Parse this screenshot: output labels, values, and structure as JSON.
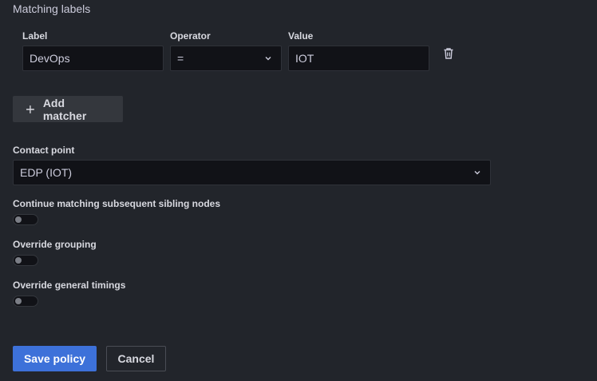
{
  "matching_labels": {
    "title": "Matching labels",
    "columns": {
      "label": "Label",
      "operator": "Operator",
      "value": "Value"
    },
    "row": {
      "label_value": "DevOps",
      "operator_value": "=",
      "value_value": "IOT"
    },
    "icons": {
      "delete": "trash-icon",
      "dropdown": "chevron-down-icon"
    }
  },
  "add_matcher": {
    "icon": "plus-icon",
    "label": "Add matcher"
  },
  "contact_point": {
    "label": "Contact point",
    "value": "EDP (IOT)"
  },
  "toggles": [
    {
      "label": "Continue matching subsequent sibling nodes",
      "on": false
    },
    {
      "label": "Override grouping",
      "on": false
    },
    {
      "label": "Override general timings",
      "on": false
    }
  ],
  "actions": {
    "save": "Save policy",
    "cancel": "Cancel"
  },
  "colors": {
    "background": "#22252b",
    "input_bg": "#111217",
    "primary": "#3d71d9"
  }
}
